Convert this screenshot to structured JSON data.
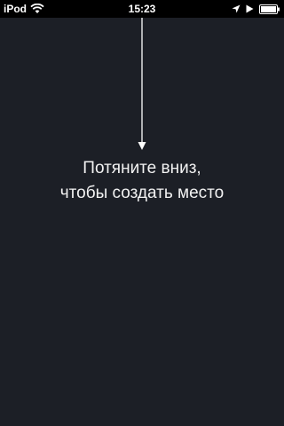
{
  "status_bar": {
    "carrier": "iPod",
    "time": "15:23",
    "icons": [
      "wifi-icon",
      "location-arrow-icon",
      "play-icon",
      "battery-icon"
    ]
  },
  "main": {
    "hint_line1": "Потяните вниз,",
    "hint_line2": "чтобы создать место"
  },
  "colors": {
    "background": "#1c1f26",
    "status_bar": "#000000",
    "text": "#f2f2f2",
    "arrow": "#ffffff"
  }
}
